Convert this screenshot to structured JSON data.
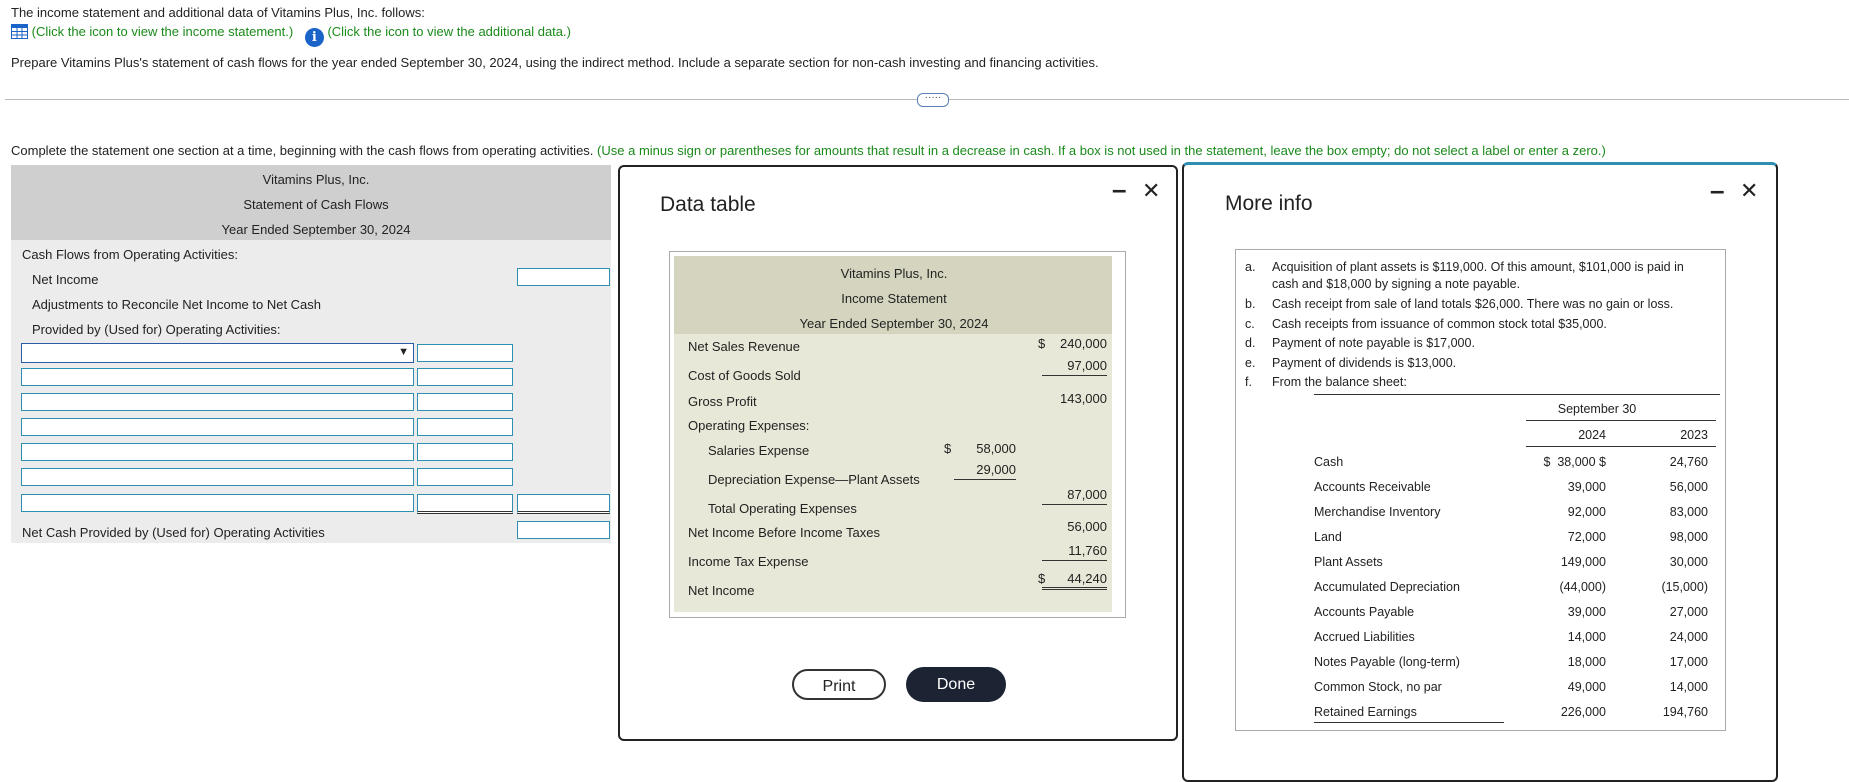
{
  "question": {
    "intro": "The income statement and additional data of Vitamins Plus, Inc. follows:",
    "link1": "(Click the icon to view the income statement.)",
    "link2": "(Click the icon to view the additional data.)",
    "prompt": "Prepare Vitamins Plus's statement of cash flows for the year ended September 30, 2024, using the indirect method. Include a separate section for non-cash investing and financing activities.",
    "expand": "·····",
    "instruction": "Complete the statement one section at a time, beginning with the cash flows from operating activities.",
    "instruction_note": "(Use a minus sign or parentheses for amounts that result in a decrease in cash. If a box is not used in the statement, leave the box empty; do not select a label or enter a zero.)"
  },
  "statement": {
    "company": "Vitamins Plus, Inc.",
    "title": "Statement of Cash Flows",
    "period": "Year Ended September 30, 2024",
    "section": "Cash Flows from Operating Activities:",
    "net_income": "Net Income",
    "adj1": "Adjustments to Reconcile Net Income to Net Cash",
    "adj2": "Provided by (Used for) Operating Activities:",
    "net_cash": "Net Cash Provided by (Used for) Operating Activities",
    "dropdown_arrow": "▼"
  },
  "data_table": {
    "title": "Data table",
    "minimize": "–",
    "close": "✕",
    "company": "Vitamins Plus, Inc.",
    "statement": "Income Statement",
    "period": "Year Ended September 30, 2024",
    "rows": {
      "net_sales": {
        "label": "Net Sales Revenue",
        "cur": "$",
        "value": "240,000"
      },
      "cogs": {
        "label": "Cost of Goods Sold",
        "value": "97,000"
      },
      "gross": {
        "label": "Gross Profit",
        "value": "143,000"
      },
      "opex": {
        "label": "Operating Expenses:"
      },
      "salaries": {
        "label": "Salaries Expense",
        "cur": "$",
        "value": "58,000"
      },
      "depr": {
        "label": "Depreciation Expense—Plant Assets",
        "value": "29,000"
      },
      "total_opex": {
        "label": "Total Operating Expenses",
        "value": "87,000"
      },
      "nibt": {
        "label": "Net Income Before Income Taxes",
        "value": "56,000"
      },
      "tax": {
        "label": "Income Tax Expense",
        "value": "11,760"
      },
      "net_income": {
        "label": "Net Income",
        "cur": "$",
        "value": "44,240"
      }
    },
    "print": "Print",
    "done": "Done"
  },
  "more_info": {
    "title": "More info",
    "minimize": "–",
    "close": "✕",
    "items": [
      {
        "key": "a.",
        "text1": "Acquisition of plant assets is $119,000. Of this amount, $101,000 is paid in",
        "text2": "cash and $18,000 by signing a note payable."
      },
      {
        "key": "b.",
        "text1": "Cash receipt from sale of land totals $26,000. There was no gain or loss."
      },
      {
        "key": "c.",
        "text1": "Cash receipts from issuance of common stock total $35,000."
      },
      {
        "key": "d.",
        "text1": "Payment of note payable is $17,000."
      },
      {
        "key": "e.",
        "text1": "Payment of dividends is $13,000."
      },
      {
        "key": "f.",
        "text1": "From the balance sheet:"
      }
    ],
    "balance_sheet": {
      "header": "September 30",
      "years": [
        "2024",
        "2023"
      ],
      "rows": [
        {
          "label": "Cash",
          "y2024": "$  38,000 $",
          "y2023": "24,760"
        },
        {
          "label": "Accounts Receivable",
          "y2024": "39,000",
          "y2023": "56,000"
        },
        {
          "label": "Merchandise Inventory",
          "y2024": "92,000",
          "y2023": "83,000"
        },
        {
          "label": "Land",
          "y2024": "72,000",
          "y2023": "98,000"
        },
        {
          "label": "Plant Assets",
          "y2024": "149,000",
          "y2023": "30,000"
        },
        {
          "label": "Accumulated Depreciation",
          "y2024": "(44,000)",
          "y2023": "(15,000)"
        },
        {
          "label": "Accounts Payable",
          "y2024": "39,000",
          "y2023": "27,000"
        },
        {
          "label": "Accrued Liabilities",
          "y2024": "14,000",
          "y2023": "24,000"
        },
        {
          "label": "Notes Payable (long-term)",
          "y2024": "18,000",
          "y2023": "17,000"
        },
        {
          "label": "Common Stock, no par",
          "y2024": "49,000",
          "y2023": "14,000"
        },
        {
          "label": "Retained Earnings",
          "y2024": "226,000",
          "y2023": "194,760"
        }
      ]
    }
  }
}
